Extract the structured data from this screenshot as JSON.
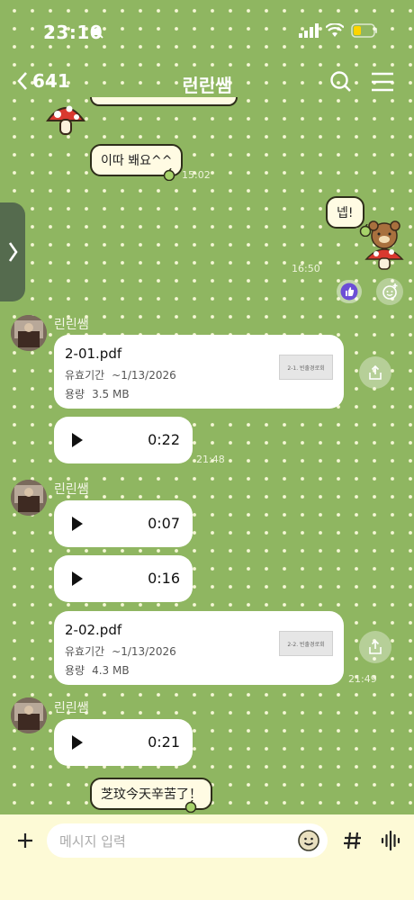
{
  "status": {
    "time": "23:10"
  },
  "header": {
    "back_count": "641",
    "title": "린린쌤"
  },
  "messages": {
    "m1_text": "이따 봬요^^",
    "m1_time": "15:02",
    "m2_text": "넵!",
    "m2_time": "16:50",
    "sender_name": "린린쌤",
    "file1": {
      "name": "2-01.pdf",
      "validity_label": "유효기간",
      "validity_value": "~1/13/2026",
      "size_label": "용량",
      "size_value": "3.5 MB",
      "thumb_title": "2-1. 빈출경로회"
    },
    "voice1": "0:22",
    "time_2148": "21:48",
    "voice2": "0:07",
    "voice3": "0:16",
    "file2": {
      "name": "2-02.pdf",
      "validity_label": "유효기간",
      "validity_value": "~1/13/2026",
      "size_label": "용량",
      "size_value": "4.3 MB",
      "thumb_title": "2-2. 빈출경로회"
    },
    "time_2149": "21:49",
    "voice4": "0:21",
    "last_text": "芝玟今天辛苦了！"
  },
  "input": {
    "placeholder": "메시지 입력"
  },
  "colors": {
    "background": "#8fb661",
    "bubble": "#fffbe3",
    "input_bar": "#fdfad6"
  }
}
